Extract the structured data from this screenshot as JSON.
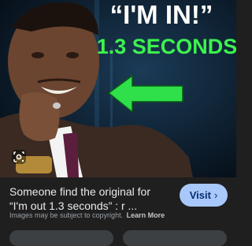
{
  "image": {
    "headline_quote": "“I'M IN!”",
    "headline_sub": "1.3 SECONDS",
    "colors": {
      "headline": "#ffffff",
      "sub_headline": "#3df24f",
      "arrow": "#2fe04a"
    }
  },
  "result": {
    "caption": "Someone find the original for “I'm out 1.3 seconds” : r ...",
    "visit_label": "Visit",
    "visit_chevron": "›",
    "disclaimer": "Images may be subject to copyright.",
    "learn_more": "Learn More"
  },
  "icons": {
    "lens": "google-lens-icon",
    "visit_chevron": "chevron-right-icon"
  },
  "theme": {
    "background": "#1f1f1f",
    "accent": "#a8c7fa",
    "accent_text": "#062e6f"
  }
}
